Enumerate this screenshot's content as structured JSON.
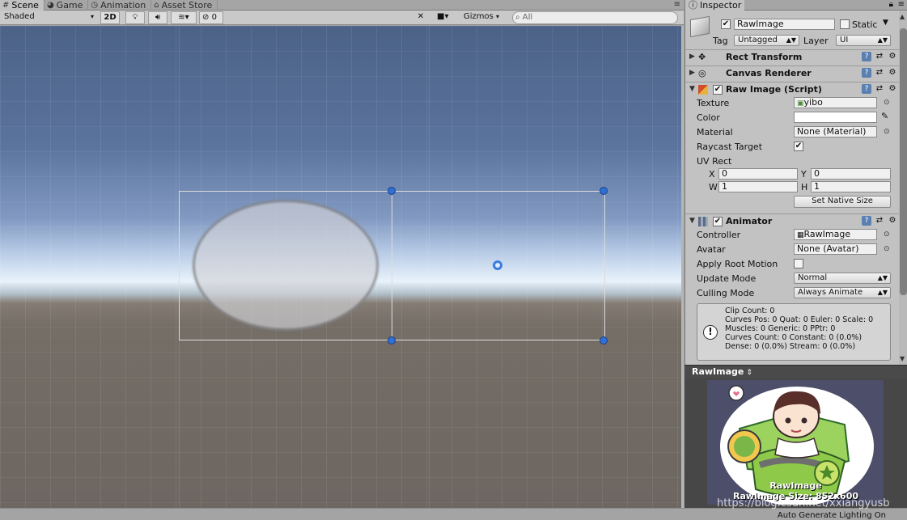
{
  "scene_tabs": [
    {
      "label": "Scene",
      "icon": "grid-icon"
    },
    {
      "label": "Game",
      "icon": "pacman-icon"
    },
    {
      "label": "Animation",
      "icon": "clock-icon"
    },
    {
      "label": "Asset Store",
      "icon": "store-icon"
    }
  ],
  "scene_toolbar": {
    "shading_mode": "Shaded",
    "mode_2d": "2D",
    "effects_count": "0",
    "gizmos": "Gizmos",
    "search_placeholder": "All"
  },
  "inspector": {
    "tab_label": "Inspector",
    "object_name": "RawImage",
    "static_label": "Static",
    "tag_label": "Tag",
    "tag_value": "Untagged",
    "layer_label": "Layer",
    "layer_value": "UI",
    "components": {
      "rect_transform": "Rect Transform",
      "canvas_renderer": "Canvas Renderer",
      "raw_image": "Raw Image (Script)",
      "animator": "Animator"
    },
    "raw_image": {
      "texture_label": "Texture",
      "texture_value": "yibo",
      "color_label": "Color",
      "color_value": "#ffffff",
      "material_label": "Material",
      "material_value": "None (Material)",
      "raycast_label": "Raycast Target",
      "uv_rect_label": "UV Rect",
      "x_label": "X",
      "x_value": "0",
      "y_label": "Y",
      "y_value": "0",
      "w_label": "W",
      "w_value": "1",
      "h_label": "H",
      "h_value": "1",
      "set_native_size": "Set Native Size"
    },
    "animator": {
      "controller_label": "Controller",
      "controller_value": "RawImage",
      "avatar_label": "Avatar",
      "avatar_value": "None (Avatar)",
      "apply_root_motion_label": "Apply Root Motion",
      "update_mode_label": "Update Mode",
      "update_mode_value": "Normal",
      "culling_mode_label": "Culling Mode",
      "culling_mode_value": "Always Animate",
      "info_lines": [
        "Clip Count: 0",
        "Curves Pos: 0 Quat: 0 Euler: 0 Scale: 0",
        "Muscles: 0 Generic: 0 PPtr: 0",
        "Curves Count: 0 Constant: 0 (0.0%)",
        "Dense: 0 (0.0%) Stream: 0 (0.0%)"
      ]
    }
  },
  "preview": {
    "title": "RawImage",
    "caption_name": "RawImage",
    "caption_size": "RawImage Size: 852x600"
  },
  "status": {
    "right_text": "Auto Generate Lighting On"
  },
  "watermark": "https://blog.csdn.net/xxiangyusb"
}
